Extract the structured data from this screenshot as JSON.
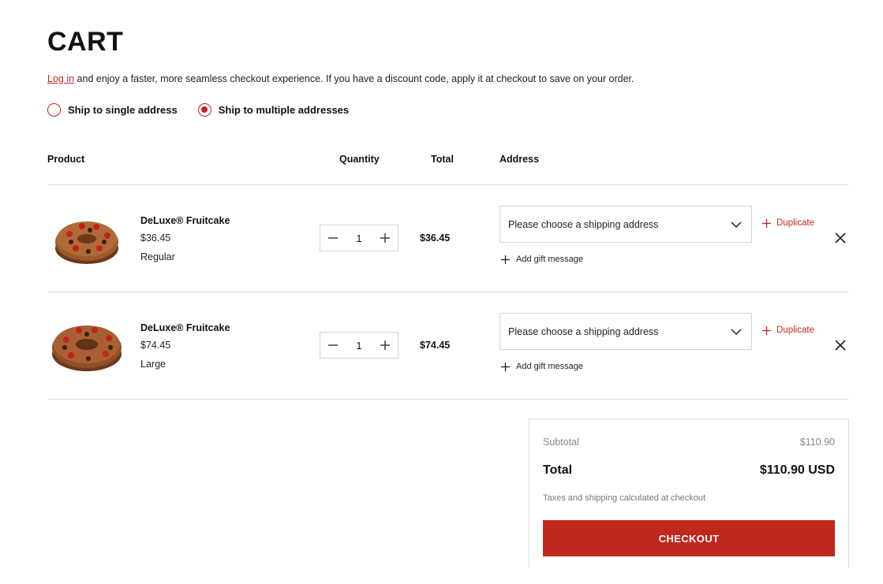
{
  "page": {
    "title": "CART"
  },
  "intro": {
    "login_link": "Log in",
    "text": " and enjoy a faster, more seamless checkout experience. If you have a discount code, apply it at checkout to save on your order."
  },
  "shipping_options": [
    {
      "label": "Ship to single address",
      "selected": false
    },
    {
      "label": "Ship to multiple addresses",
      "selected": true
    }
  ],
  "columns": {
    "product": "Product",
    "quantity": "Quantity",
    "total": "Total",
    "address": "Address"
  },
  "items": [
    {
      "name": "DeLuxe® Fruitcake",
      "price": "$36.45",
      "variant": "Regular",
      "quantity": "1",
      "total": "$36.45",
      "address_placeholder": "Please choose a shipping address",
      "duplicate_label": "Duplicate",
      "gift_label": "Add gift message"
    },
    {
      "name": "DeLuxe® Fruitcake",
      "price": "$74.45",
      "variant": "Large",
      "quantity": "1",
      "total": "$74.45",
      "address_placeholder": "Please choose a shipping address",
      "duplicate_label": "Duplicate",
      "gift_label": "Add gift message"
    }
  ],
  "summary": {
    "subtotal_label": "Subtotal",
    "subtotal_value": "$110.90",
    "total_label": "Total",
    "total_value": "$110.90 USD",
    "tax_note": "Taxes and shipping calculated at checkout",
    "checkout_label": "CHECKOUT"
  },
  "icons": {
    "minus": "minus-icon",
    "plus": "plus-icon",
    "chevron": "chevron-down-icon",
    "close": "close-icon",
    "image": "fruitcake-image"
  },
  "colors": {
    "accent": "#c0271d",
    "border": "#d4d4d4",
    "muted": "#888888"
  }
}
